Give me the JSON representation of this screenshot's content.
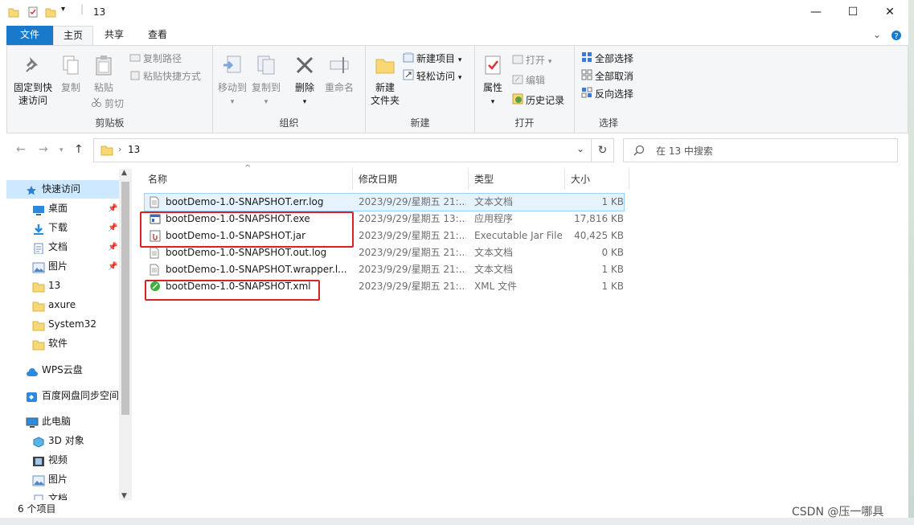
{
  "window": {
    "title": "13",
    "minimize": "—",
    "maximize": "☐",
    "close": "✕"
  },
  "tabs": {
    "file": "文件",
    "home": "主页",
    "share": "共享",
    "view": "查看"
  },
  "ribbon": {
    "clipboard": {
      "label": "剪贴板",
      "pin": "固定到快\n速访问",
      "pin_l1": "固定到快",
      "pin_l2": "速访问",
      "copy": "复制",
      "paste": "粘贴",
      "copy_path": "复制路径",
      "paste_shortcut": "粘贴快捷方式",
      "cut": "剪切"
    },
    "organize": {
      "label": "组织",
      "move_to": "移动到",
      "copy_to": "复制到",
      "delete": "删除",
      "rename": "重命名"
    },
    "new": {
      "label": "新建",
      "new_folder_l1": "新建",
      "new_folder_l2": "文件夹",
      "new_item": "新建项目",
      "easy_access": "轻松访问"
    },
    "open": {
      "label": "打开",
      "properties": "属性",
      "open": "打开",
      "edit": "编辑",
      "history": "历史记录"
    },
    "select": {
      "label": "选择",
      "select_all": "全部选择",
      "select_none": "全部取消",
      "invert": "反向选择"
    }
  },
  "address": {
    "path": "13",
    "search_placeholder": "在 13 中搜索"
  },
  "nav": {
    "quick_access": "快速访问",
    "items": [
      {
        "label": "桌面",
        "pinned": true
      },
      {
        "label": "下载",
        "pinned": true
      },
      {
        "label": "文档",
        "pinned": true
      },
      {
        "label": "图片",
        "pinned": true
      },
      {
        "label": "13",
        "pinned": false
      },
      {
        "label": "axure",
        "pinned": false
      },
      {
        "label": "System32",
        "pinned": false
      },
      {
        "label": "软件",
        "pinned": false
      }
    ],
    "wps": "WPS云盘",
    "baidu": "百度网盘同步空间",
    "this_pc": "此电脑",
    "pc_items": [
      "3D 对象",
      "视频",
      "图片",
      "文档"
    ]
  },
  "columns": {
    "name": "名称",
    "date": "修改日期",
    "type": "类型",
    "size": "大小"
  },
  "files": [
    {
      "name": "bootDemo-1.0-SNAPSHOT.err.log",
      "date": "2023/9/29/星期五 21:...",
      "type": "文本文档",
      "size": "1 KB",
      "icon": "text-file-icon"
    },
    {
      "name": "bootDemo-1.0-SNAPSHOT.exe",
      "date": "2023/9/29/星期五 13:...",
      "type": "应用程序",
      "size": "17,816 KB",
      "icon": "exe-file-icon"
    },
    {
      "name": "bootDemo-1.0-SNAPSHOT.jar",
      "date": "2023/9/29/星期五 21:...",
      "type": "Executable Jar File",
      "size": "40,425 KB",
      "icon": "jar-file-icon"
    },
    {
      "name": "bootDemo-1.0-SNAPSHOT.out.log",
      "date": "2023/9/29/星期五 21:...",
      "type": "文本文档",
      "size": "0 KB",
      "icon": "text-file-icon"
    },
    {
      "name": "bootDemo-1.0-SNAPSHOT.wrapper.l...",
      "date": "2023/9/29/星期五 21:...",
      "type": "文本文档",
      "size": "1 KB",
      "icon": "text-file-icon"
    },
    {
      "name": "bootDemo-1.0-SNAPSHOT.xml",
      "date": "2023/9/29/星期五 21:...",
      "type": "XML 文件",
      "size": "1 KB",
      "icon": "xml-file-icon"
    }
  ],
  "status": {
    "count": "6 个项目"
  },
  "watermark": "CSDN @压一哪具",
  "colors": {
    "accent": "#1979ca",
    "highlight_box": "#e02020",
    "folder": "#f8d775"
  }
}
